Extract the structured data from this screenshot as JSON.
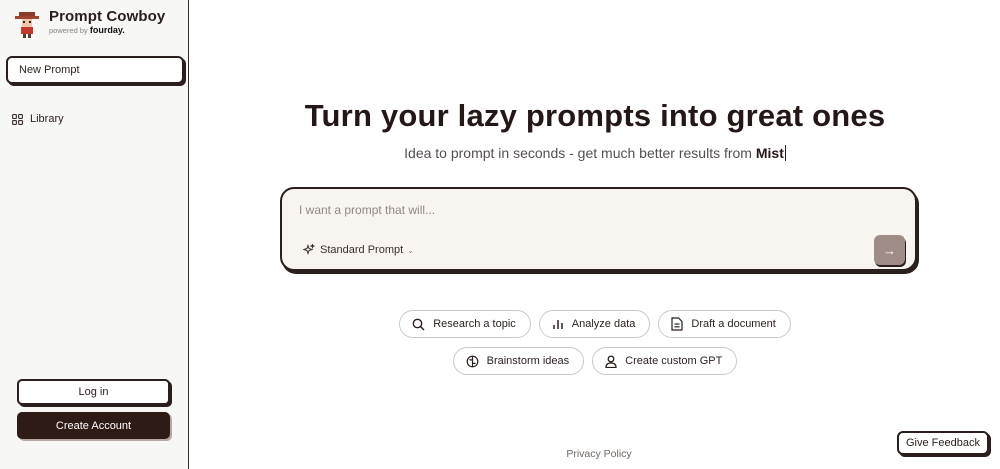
{
  "brand": {
    "name": "Prompt Cowboy",
    "powered_by": "powered by",
    "partner": "fourday."
  },
  "sidebar": {
    "new_prompt": "New Prompt",
    "items": [
      {
        "label": "Library",
        "icon": "grid-icon"
      }
    ],
    "login": "Log in",
    "create_account": "Create Account"
  },
  "main": {
    "headline": "Turn your lazy prompts into great ones",
    "subline_prefix": "Idea to prompt in seconds - get much better results from ",
    "subline_model": "Mist",
    "prompt_placeholder": "I want a prompt that will...",
    "prompt_value": "",
    "mode": "Standard Prompt",
    "send_icon": "arrow-right-icon",
    "chips": [
      {
        "label": "Research a topic",
        "icon": "search-icon"
      },
      {
        "label": "Analyze data",
        "icon": "bar-chart-icon"
      },
      {
        "label": "Draft a document",
        "icon": "document-icon"
      },
      {
        "label": "Brainstorm ideas",
        "icon": "brain-icon"
      },
      {
        "label": "Create custom GPT",
        "icon": "user-icon"
      }
    ]
  },
  "footer": {
    "privacy": "Privacy Policy",
    "feedback": "Give Feedback"
  },
  "colors": {
    "primary_dark": "#2e1b16",
    "prompt_bg": "#f8f5f1",
    "send_button": "#a08c86",
    "sidebar_bg": "#f7f7f6"
  }
}
